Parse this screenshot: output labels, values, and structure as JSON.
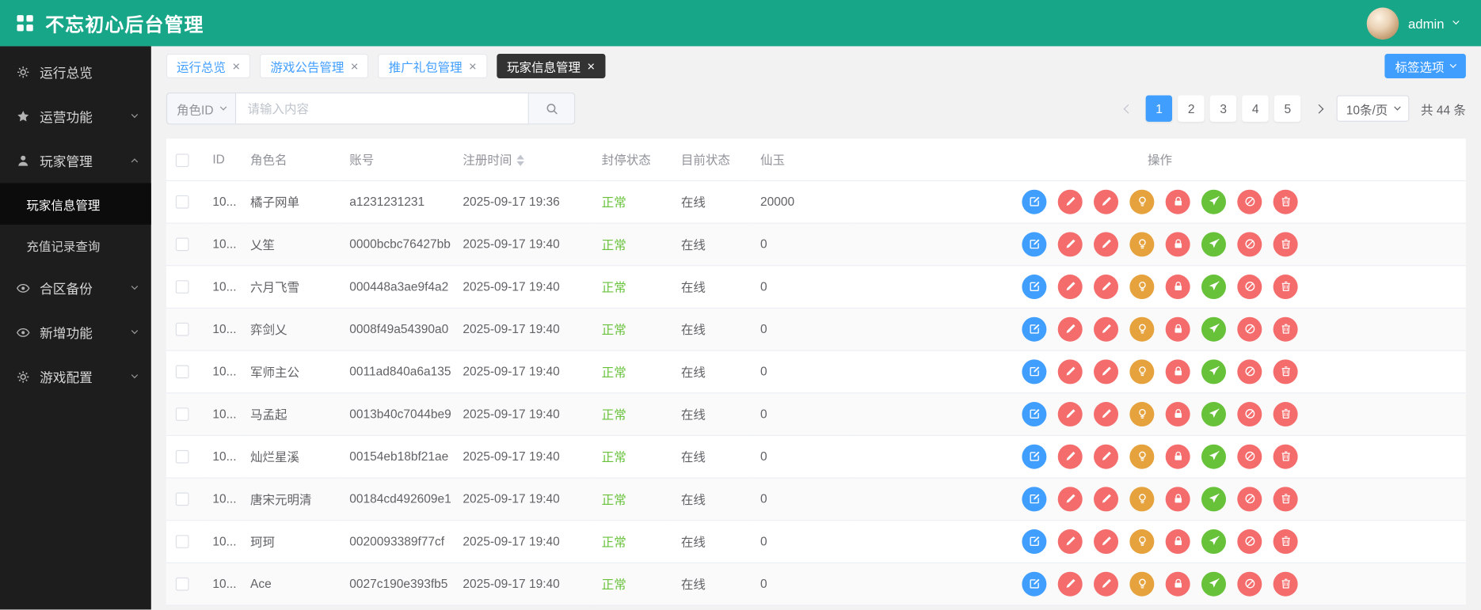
{
  "colors": {
    "topbar": "#18a689",
    "sidebar": "#1d1d1d",
    "primary": "#409eff",
    "danger": "#f56c6c",
    "warning": "#e6a23c",
    "success": "#67c23a"
  },
  "header": {
    "title": "不忘初心后台管理",
    "username": "admin"
  },
  "sidebar": {
    "items": [
      {
        "icon": "gear-icon",
        "label": "运行总览",
        "expandable": false,
        "expanded": false,
        "children": []
      },
      {
        "icon": "star-icon",
        "label": "运营功能",
        "expandable": true,
        "expanded": false,
        "children": []
      },
      {
        "icon": "user-icon",
        "label": "玩家管理",
        "expandable": true,
        "expanded": true,
        "children": [
          {
            "label": "玩家信息管理",
            "active": true
          },
          {
            "label": "充值记录查询",
            "active": false
          }
        ]
      },
      {
        "icon": "eye-icon",
        "label": "合区备份",
        "expandable": true,
        "expanded": false,
        "children": []
      },
      {
        "icon": "eye-icon",
        "label": "新增功能",
        "expandable": true,
        "expanded": false,
        "children": []
      },
      {
        "icon": "gear-icon",
        "label": "游戏配置",
        "expandable": true,
        "expanded": false,
        "children": []
      }
    ]
  },
  "tabs": {
    "items": [
      {
        "label": "运行总览",
        "active": false
      },
      {
        "label": "游戏公告管理",
        "active": false
      },
      {
        "label": "推广礼包管理",
        "active": false
      },
      {
        "label": "玩家信息管理",
        "active": true
      }
    ],
    "options_button_label": "标签选项"
  },
  "search": {
    "field_select_value": "角色ID",
    "input_placeholder": "请输入内容"
  },
  "pagination": {
    "pages": [
      "1",
      "2",
      "3",
      "4",
      "5"
    ],
    "active_page": "1",
    "page_size_value": "10条/页",
    "total_label": "共 44 条"
  },
  "table": {
    "columns": [
      {
        "label": "ID",
        "key": "id"
      },
      {
        "label": "角色名",
        "key": "name"
      },
      {
        "label": "账号",
        "key": "account"
      },
      {
        "label": "注册时间",
        "key": "reg_time",
        "sortable": true
      },
      {
        "label": "封停状态",
        "key": "ban_status"
      },
      {
        "label": "目前状态",
        "key": "online_status"
      },
      {
        "label": "仙玉",
        "key": "jade"
      },
      {
        "label": "操作",
        "key": "actions",
        "align": "center"
      }
    ],
    "rows": [
      {
        "id": "10...",
        "name": "橘子网单",
        "account": "a1231231231",
        "reg_time": "2025-09-17 19:36",
        "ban_status": "正常",
        "online_status": "在线",
        "jade": "20000"
      },
      {
        "id": "10...",
        "name": "乂笙",
        "account": "0000bcbc76427bb",
        "reg_time": "2025-09-17 19:40",
        "ban_status": "正常",
        "online_status": "在线",
        "jade": "0"
      },
      {
        "id": "10...",
        "name": "六月飞雪",
        "account": "000448a3ae9f4a2",
        "reg_time": "2025-09-17 19:40",
        "ban_status": "正常",
        "online_status": "在线",
        "jade": "0"
      },
      {
        "id": "10...",
        "name": "弈剑乂",
        "account": "0008f49a54390a0",
        "reg_time": "2025-09-17 19:40",
        "ban_status": "正常",
        "online_status": "在线",
        "jade": "0"
      },
      {
        "id": "10...",
        "name": "军师主公",
        "account": "0011ad840a6a135",
        "reg_time": "2025-09-17 19:40",
        "ban_status": "正常",
        "online_status": "在线",
        "jade": "0"
      },
      {
        "id": "10...",
        "name": "马孟起",
        "account": "0013b40c7044be9",
        "reg_time": "2025-09-17 19:40",
        "ban_status": "正常",
        "online_status": "在线",
        "jade": "0"
      },
      {
        "id": "10...",
        "name": "灿烂星溪",
        "account": "00154eb18bf21ae",
        "reg_time": "2025-09-17 19:40",
        "ban_status": "正常",
        "online_status": "在线",
        "jade": "0"
      },
      {
        "id": "10...",
        "name": "唐宋元明清",
        "account": "00184cd492609e1",
        "reg_time": "2025-09-17 19:40",
        "ban_status": "正常",
        "online_status": "在线",
        "jade": "0"
      },
      {
        "id": "10...",
        "name": "珂珂",
        "account": "0020093389f77cf",
        "reg_time": "2025-09-17 19:40",
        "ban_status": "正常",
        "online_status": "在线",
        "jade": "0"
      },
      {
        "id": "10...",
        "name": "Ace",
        "account": "0027c190e393fb5",
        "reg_time": "2025-09-17 19:40",
        "ban_status": "正常",
        "online_status": "在线",
        "jade": "0"
      }
    ],
    "row_actions": [
      {
        "icon": "edit-icon",
        "color": "#409eff"
      },
      {
        "icon": "pen-icon",
        "color": "#f56c6c"
      },
      {
        "icon": "pen-icon",
        "color": "#f56c6c"
      },
      {
        "icon": "bulb-icon",
        "color": "#e6a23c"
      },
      {
        "icon": "lock-icon",
        "color": "#f56c6c"
      },
      {
        "icon": "send-icon",
        "color": "#67c23a"
      },
      {
        "icon": "ban-icon",
        "color": "#f56c6c"
      },
      {
        "icon": "trash-icon",
        "color": "#f56c6c"
      }
    ]
  }
}
